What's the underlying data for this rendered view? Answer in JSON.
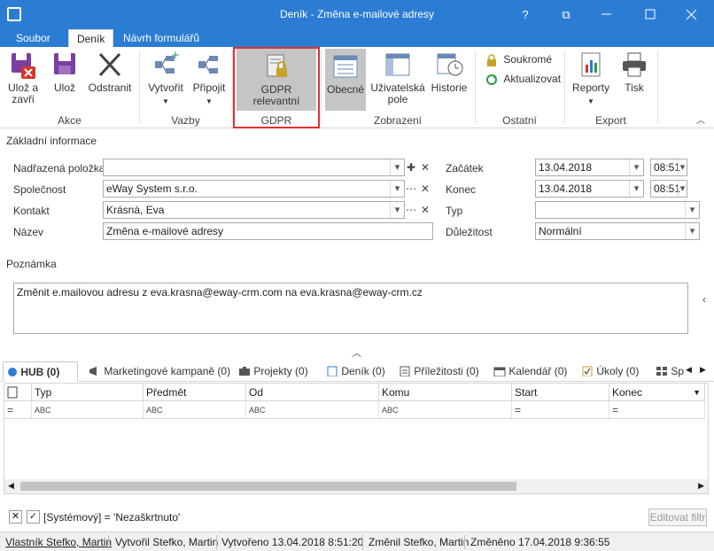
{
  "window": {
    "title": "Deník - Změna e-mailové adresy",
    "help": "?",
    "restore": "⧉",
    "minimize": "—",
    "maximize": "☐",
    "close": "✕"
  },
  "tabs": [
    "Soubor",
    "Deník",
    "Návrh formulářů"
  ],
  "ribbon": {
    "save_close": "Ulož a zavři",
    "save": "Ulož",
    "delete": "Odstranit",
    "create": "Vytvořit",
    "attach": "Připojit",
    "gdpr_relevant": "GDPR relevantní",
    "general": "Obecné",
    "user_fields": "Uživatelská pole",
    "history": "Historie",
    "private": "Soukromé",
    "update": "Aktualizovat",
    "reports": "Reporty",
    "print": "Tisk",
    "groups": {
      "actions": "Akce",
      "relations": "Vazby",
      "gdpr": "GDPR",
      "view": "Zobrazení",
      "other": "Ostatní",
      "export": "Export"
    }
  },
  "form": {
    "basic_info": "Základní informace",
    "parent_item_label": "Nadřazená položka",
    "parent_item_value": "",
    "company_label": "Společnost",
    "company_value": "eWay System s.r.o.",
    "contact_label": "Kontakt",
    "contact_value": "Krásná,  Eva",
    "name_label": "Název",
    "name_value": "Změna e-mailové adresy",
    "start_label": "Začátek",
    "start_date": "13.04.2018",
    "start_time": "08:51",
    "end_label": "Konec",
    "end_date": "13.04.2018",
    "end_time": "08:51",
    "type_label": "Typ",
    "type_value": "",
    "importance_label": "Důležitost",
    "importance_value": "Normální",
    "note_label": "Poznámka",
    "note_value": "Změnit e.mailovou adresu z eva.krasna@eway-crm.com na eva.krasna@eway-crm.cz"
  },
  "bottom_tabs": [
    "HUB (0)",
    "Marketingové kampaně (0)",
    "Projekty (0)",
    "Deník (0)",
    "Příležitosti (0)",
    "Kalendář (0)",
    "Úkoly (0)",
    "Sp"
  ],
  "grid": {
    "columns": [
      "Typ",
      "Předmět",
      "Od",
      "Komu",
      "Start",
      "Konec"
    ],
    "filter_eq": "=",
    "filter_abc": "ABC"
  },
  "filter": {
    "text": "[Systémový] = 'Nezaškrtnuto'",
    "edit_button": "Editovat filtr"
  },
  "status": {
    "owner": "Vlastník Stefko, Martin",
    "created_by": "Vytvořil Stefko, Martin",
    "created": "Vytvořeno 13.04.2018 8:51:20",
    "changed_by": "Změnil Stefko, Martin",
    "changed": "Změněno 17.04.2018 9:36:55"
  },
  "colors": {
    "accent": "#2b7cd3",
    "gdpr_highlight": "#e03030",
    "save_icon": "#7b3fa0",
    "delete_red": "#d9342b"
  }
}
